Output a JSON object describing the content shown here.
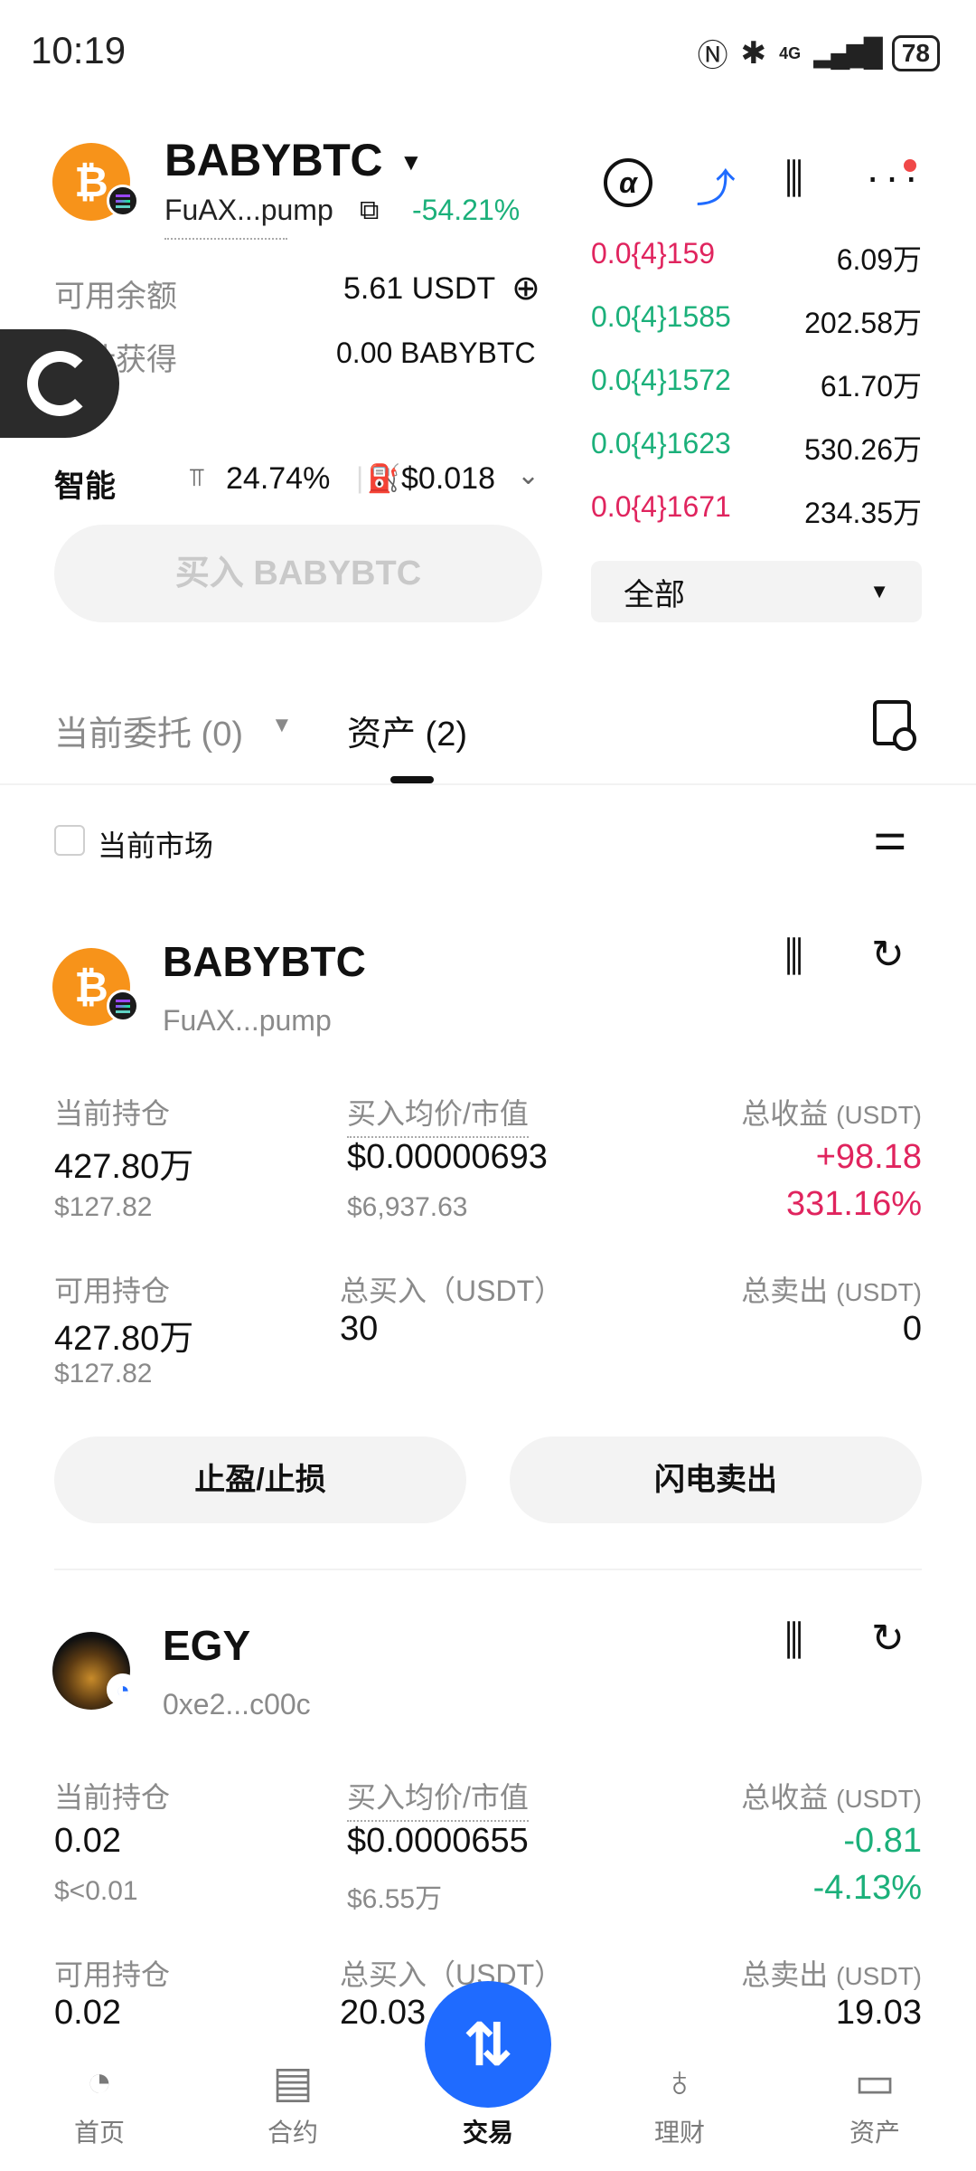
{
  "status_bar": {
    "time": "10:19",
    "battery": "78",
    "icons": [
      "nfc-icon",
      "bluetooth-icon",
      "4g-icon",
      "signal-icon"
    ],
    "network": "4G"
  },
  "token": {
    "name": "BABYBTC",
    "address": "FuAX...pump",
    "change": "-54.21%",
    "change_color": "#1bb07a",
    "coin_symbol": "₿",
    "coin_color": "#f7931a"
  },
  "form": {
    "available_label": "可用余额",
    "available_value": "5.61 USDT",
    "estimated_label": "预计获得",
    "estimated_value": "0.00 BABYBTC",
    "smart_label": "智能",
    "slippage": "24.74%",
    "gas": "$0.018",
    "buy_button": "买入 BABYBTC"
  },
  "orderbook": {
    "rows": [
      {
        "price": "0.0{4}159",
        "qty": "6.09万",
        "side": "sell"
      },
      {
        "price": "0.0{4}1585",
        "qty": "202.58万",
        "side": "buy"
      },
      {
        "price": "0.0{4}1572",
        "qty": "61.70万",
        "side": "buy"
      },
      {
        "price": "0.0{4}1623",
        "qty": "530.26万",
        "side": "buy"
      },
      {
        "price": "0.0{4}1671",
        "qty": "234.35万",
        "side": "sell"
      }
    ],
    "filter": "全部"
  },
  "tabs": {
    "orders": "当前委托 (0)",
    "assets": "资产 (2)"
  },
  "filter": {
    "current_market": "当前市场"
  },
  "holdings": [
    {
      "name": "BABYBTC",
      "address": "FuAX...pump",
      "position_label": "当前持仓",
      "position": "427.80万",
      "position_usd": "$127.82",
      "avg_label": "买入均价/市值",
      "avg_price": "$0.00000693",
      "mcap": "$6,937.63",
      "pnl_label": "总收益",
      "pnl_unit": "(USDT)",
      "pnl": "+98.18",
      "pnl_pct": "331.16%",
      "available_label": "可用持仓",
      "available": "427.80万",
      "available_usd": "$127.82",
      "total_buy_label": "总买入（USDT）",
      "total_buy": "30",
      "total_sell_label": "总卖出",
      "total_sell_unit": "(USDT)",
      "total_sell": "0",
      "tp_sl_button": "止盈/止损",
      "flash_sell_button": "闪电卖出"
    },
    {
      "name": "EGY",
      "address": "0xe2...c00c",
      "position_label": "当前持仓",
      "position": "0.02",
      "position_usd": "$<0.01",
      "avg_label": "买入均价/市值",
      "avg_price": "$0.0000655",
      "mcap": "$6.55万",
      "pnl_label": "总收益",
      "pnl_unit": "(USDT)",
      "pnl": "-0.81",
      "pnl_pct": "-4.13%",
      "available_label": "可用持仓",
      "available": "0.02",
      "total_buy_label": "总买入（USDT）",
      "total_buy": "20.03",
      "total_sell_label": "总卖出",
      "total_sell_unit": "(USDT)",
      "total_sell": "19.03"
    }
  ],
  "nav": {
    "home": "首页",
    "futures": "合约",
    "trade": "交易",
    "earn": "理财",
    "assets": "资产"
  },
  "colors": {
    "up": "#1bb07a",
    "down": "#e0245e",
    "accent": "#1f6bff"
  }
}
